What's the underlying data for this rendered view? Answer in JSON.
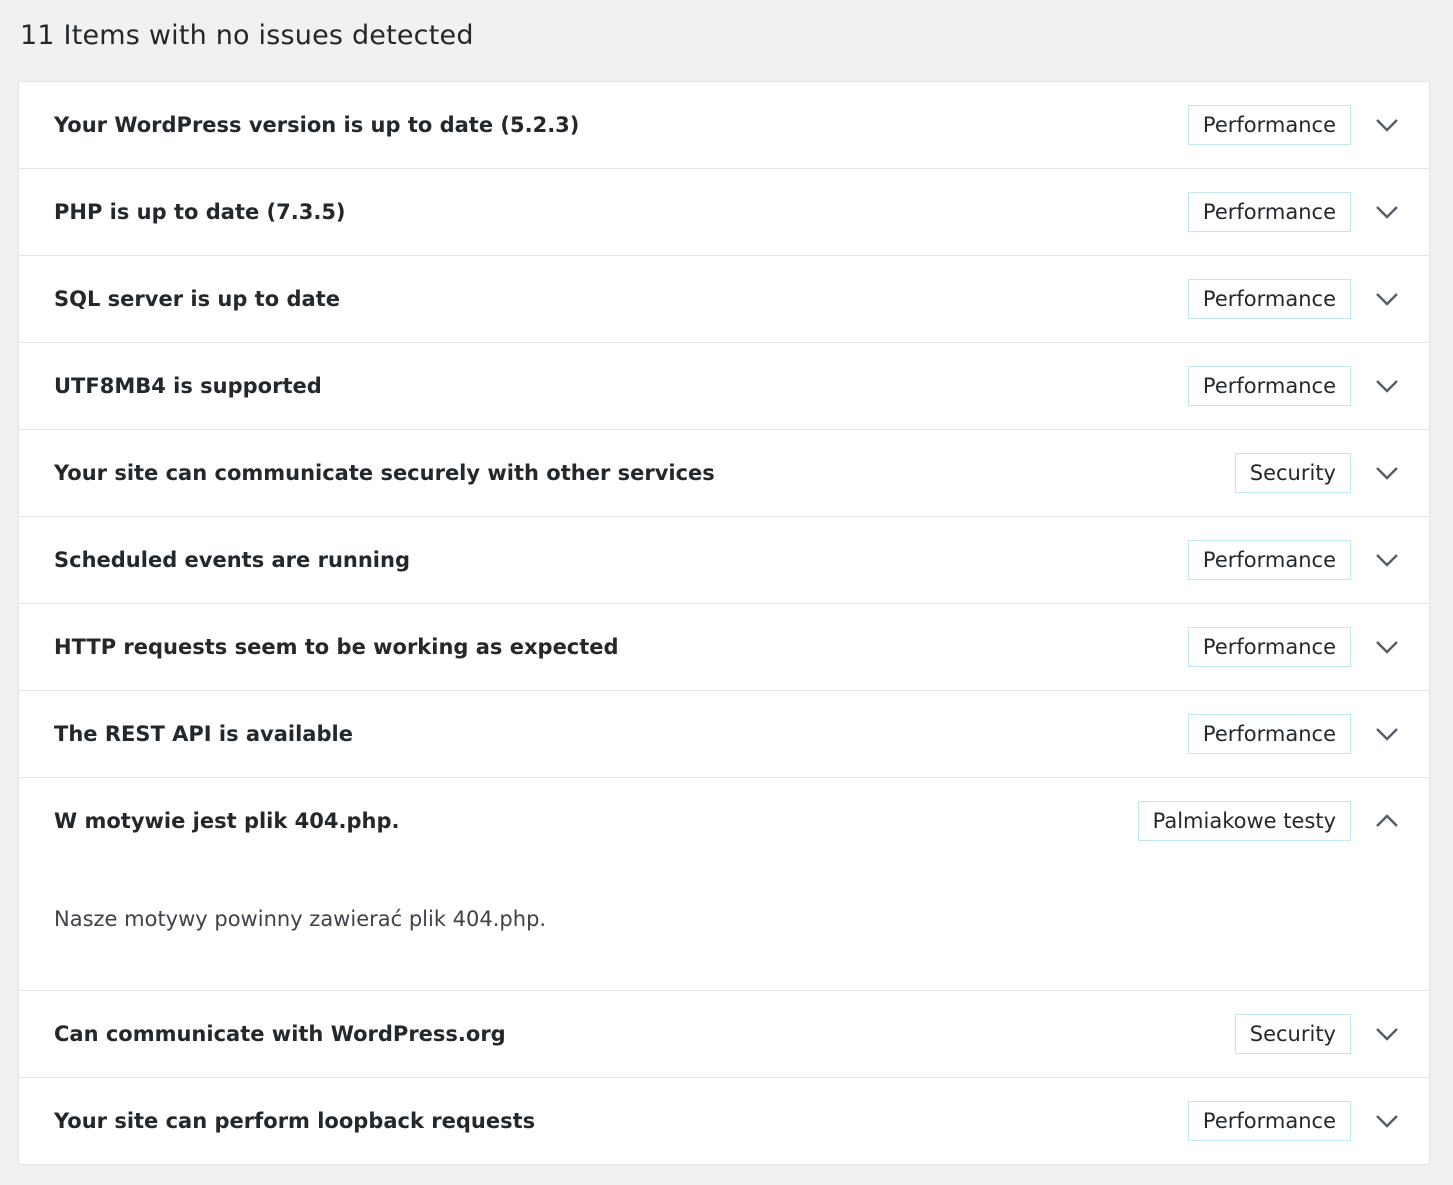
{
  "heading": "11 Items with no issues detected",
  "colors": {
    "background": "#f1f1f1",
    "panel": "#ffffff",
    "badge_border": "#bfe7f3",
    "text": "#23282d"
  },
  "items": [
    {
      "title": "Your WordPress version is up to date (5.2.3)",
      "badge": "Performance",
      "expanded": false,
      "icon": "chevron-down-icon"
    },
    {
      "title": "PHP is up to date (7.3.5)",
      "badge": "Performance",
      "expanded": false,
      "icon": "chevron-down-icon"
    },
    {
      "title": "SQL server is up to date",
      "badge": "Performance",
      "expanded": false,
      "icon": "chevron-down-icon"
    },
    {
      "title": "UTF8MB4 is supported",
      "badge": "Performance",
      "expanded": false,
      "icon": "chevron-down-icon"
    },
    {
      "title": "Your site can communicate securely with other services",
      "badge": "Security",
      "expanded": false,
      "icon": "chevron-down-icon"
    },
    {
      "title": "Scheduled events are running",
      "badge": "Performance",
      "expanded": false,
      "icon": "chevron-down-icon"
    },
    {
      "title": "HTTP requests seem to be working as expected",
      "badge": "Performance",
      "expanded": false,
      "icon": "chevron-down-icon"
    },
    {
      "title": "The REST API is available",
      "badge": "Performance",
      "expanded": false,
      "icon": "chevron-down-icon"
    },
    {
      "title": "W motywie jest plik 404.php.",
      "badge": "Palmiakowe testy",
      "expanded": true,
      "icon": "chevron-up-icon",
      "description": "Nasze motywy powinny zawierać plik 404.php."
    },
    {
      "title": "Can communicate with WordPress.org",
      "badge": "Security",
      "expanded": false,
      "icon": "chevron-down-icon"
    },
    {
      "title": "Your site can perform loopback requests",
      "badge": "Performance",
      "expanded": false,
      "icon": "chevron-down-icon"
    }
  ]
}
